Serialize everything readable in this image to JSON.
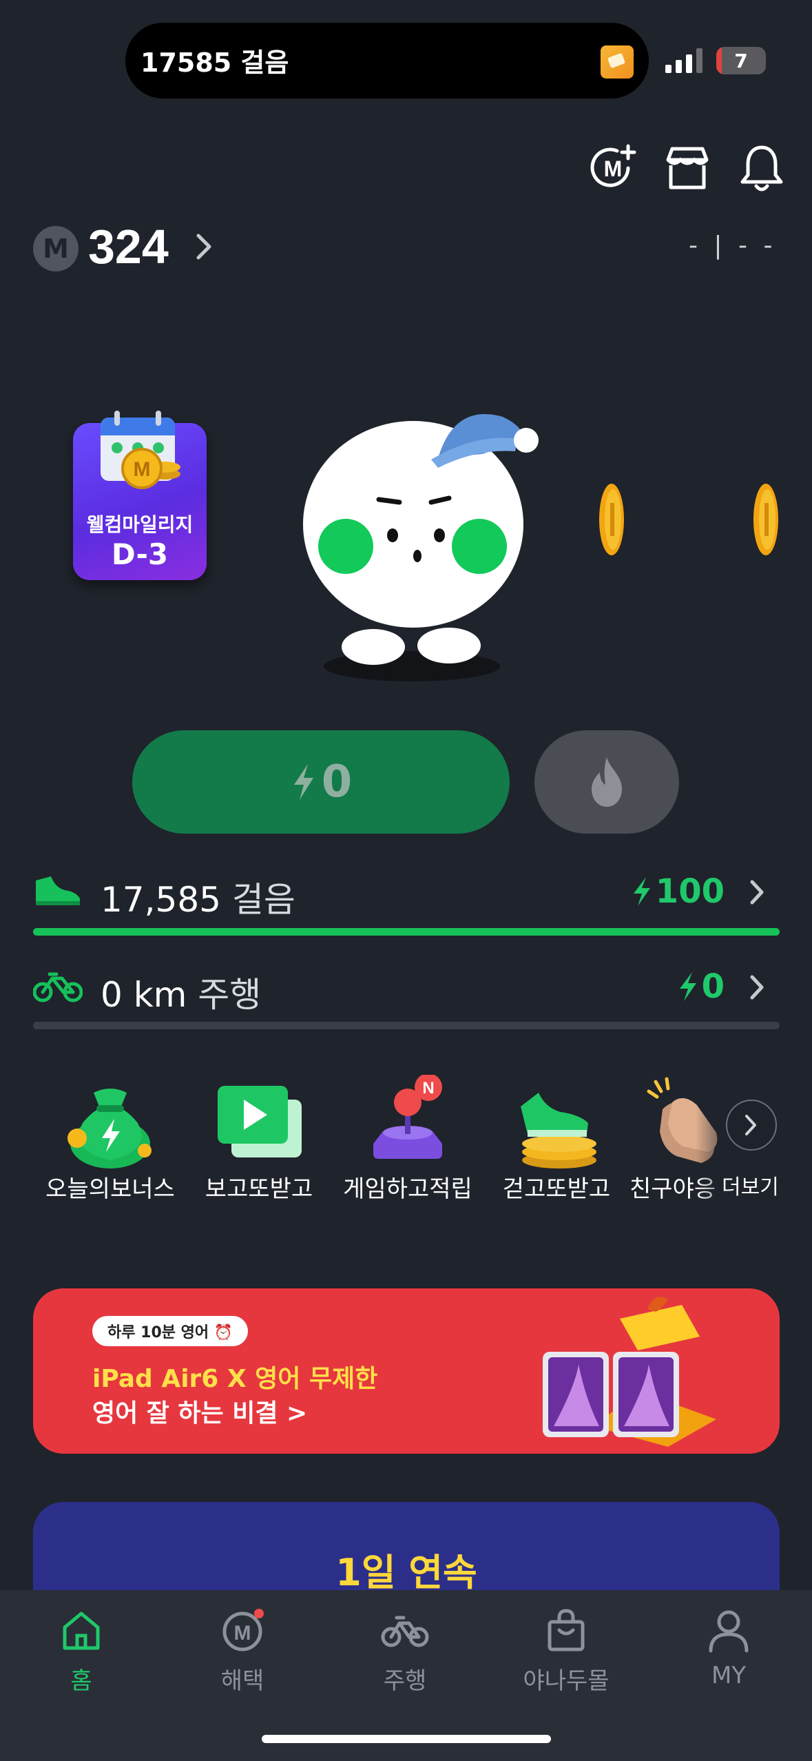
{
  "status_bar": {
    "activity_text": "17585 걸음",
    "battery_level": "7",
    "signal_icon": "signal-icon",
    "battery_icon": "battery-icon"
  },
  "header": {
    "icons": [
      "mileage-plus-icon",
      "store-icon",
      "bell-icon"
    ]
  },
  "points": {
    "badge": "M",
    "value": "324",
    "weather_placeholder": "- | - -"
  },
  "welcome_badge": {
    "title": "웰컴마일리지",
    "dday": "D-3"
  },
  "charge": {
    "value": "0",
    "accent": "#137a4a"
  },
  "steps": {
    "value": "17,585",
    "unit": "걸음",
    "reward": "100",
    "progress": 1.0
  },
  "ride": {
    "value": "0 km",
    "unit": "주행",
    "reward": "0",
    "progress": 0.0
  },
  "menu": {
    "items": [
      {
        "label": "오늘의보너스",
        "icon": "money-bag-icon"
      },
      {
        "label": "보고또받고",
        "icon": "video-play-icon"
      },
      {
        "label": "게임하고적립",
        "icon": "joystick-icon",
        "badge": "N"
      },
      {
        "label": "걷고또받고",
        "icon": "sneaker-coins-icon"
      },
      {
        "label": "친구야응",
        "icon": "clapping-hands-icon"
      }
    ],
    "more_label": "더보기"
  },
  "banner": {
    "chip": "하루 10분 영어 ⏰",
    "line1": "iPad Air6 X 영어 무제한",
    "line2": "영어 잘 하는 비결 >",
    "color": "#e6373f"
  },
  "streak": {
    "title": "1일 연속"
  },
  "tabs": [
    {
      "label": "홈",
      "icon": "home-icon",
      "active": true
    },
    {
      "label": "해택",
      "icon": "mileage-icon"
    },
    {
      "label": "주행",
      "icon": "bicycle-icon"
    },
    {
      "label": "야나두몰",
      "icon": "shopping-bag-icon"
    },
    {
      "label": "MY",
      "icon": "person-icon"
    }
  ],
  "colors": {
    "background": "#1f232b",
    "green": "#1fc86a",
    "yellow": "#ffd83a"
  }
}
